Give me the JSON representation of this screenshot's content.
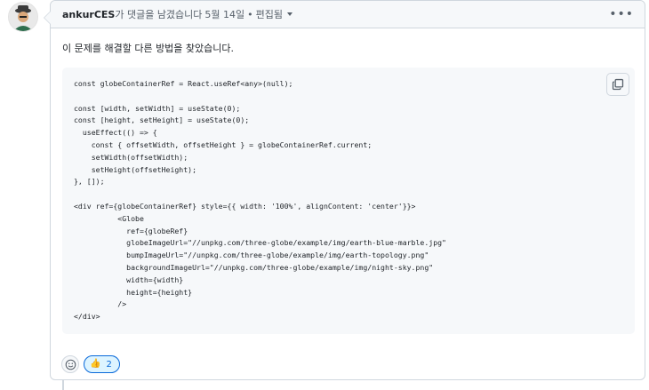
{
  "comment": {
    "author": "ankurCES",
    "header_text": "가 댓글을 남겼습니다",
    "date": "5월 14일",
    "bullet": "•",
    "edited": "편집됨",
    "body": "이 문제를 해결할 다른 방법을 찾았습니다.",
    "code": "const globeContainerRef = React.useRef<any>(null);\n\nconst [width, setWidth] = useState(0);\nconst [height, setHeight] = useState(0);\n  useEffect(() => {\n    const { offsetWidth, offsetHeight } = globeContainerRef.current;\n    setWidth(offsetWidth);\n    setHeight(offsetHeight);\n}, []);\n\n<div ref={globeContainerRef} style={{ width: '100%', alignContent: 'center'}}>\n          <Globe\n            ref={globeRef}\n            globeImageUrl=\"//unpkg.com/three-globe/example/img/earth-blue-marble.jpg\"\n            bumpImageUrl=\"//unpkg.com/three-globe/example/img/earth-topology.png\"\n            backgroundImageUrl=\"//unpkg.com/three-globe/example/img/night-sky.png\"\n            width={width}\n            height={height}\n          />\n</div>",
    "reactions": [
      {
        "icon": "thumbs-up",
        "emoji": "👍",
        "count": "2"
      }
    ]
  },
  "colors": {
    "accent": "#0969da",
    "accent_bg": "#ddf4ff",
    "header_bg": "#f6f8fa",
    "border": "#d0d7de"
  }
}
